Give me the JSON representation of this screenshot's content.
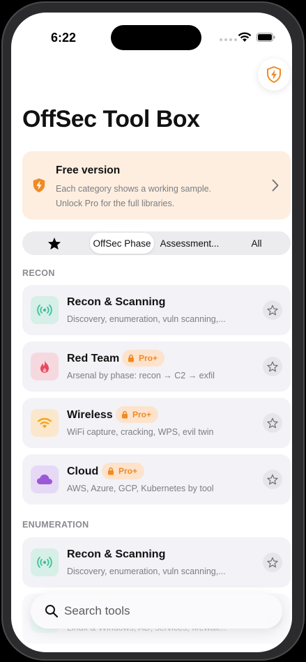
{
  "status": {
    "time": "6:22"
  },
  "title": "OffSec Tool Box",
  "banner": {
    "title": "Free version",
    "line1": "Each category shows a working sample.",
    "line2": "Unlock Pro for the full libraries."
  },
  "segments": {
    "phase": "OffSec Phase",
    "assessment": "Assessment...",
    "all": "All",
    "selected": "OffSec Phase"
  },
  "sections": [
    {
      "header": "RECON",
      "items": [
        {
          "title": "Recon & Scanning",
          "subtitle": "Discovery, enumeration, vuln scanning,...",
          "pro": false,
          "icon": "radio-waves-icon",
          "color": "#3fbf9a",
          "bg": "#d6efe7"
        },
        {
          "title": "Red Team",
          "subtitle": "Arsenal by phase: recon → C2 → exfil",
          "pro": true,
          "icon": "flame-icon",
          "color": "#e8475f",
          "bg": "#f6d9df"
        },
        {
          "title": "Wireless",
          "subtitle": "WiFi capture, cracking, WPS, evil twin",
          "pro": true,
          "icon": "wifi-icon",
          "color": "#f5a623",
          "bg": "#fbe8cc"
        },
        {
          "title": "Cloud",
          "subtitle": "AWS, Azure, GCP, Kubernetes by tool",
          "pro": true,
          "icon": "cloud-icon",
          "color": "#9b59d6",
          "bg": "#e6d9f6"
        }
      ]
    },
    {
      "header": "ENUMERATION",
      "items": [
        {
          "title": "Recon & Scanning",
          "subtitle": "Discovery, enumeration, vuln scanning,...",
          "pro": false,
          "icon": "radio-waves-icon",
          "color": "#3fbf9a",
          "bg": "#d6efe7"
        },
        {
          "title": "",
          "subtitle": "Linux & Windows, AD, services, firewall...",
          "pro": false,
          "icon": "",
          "color": "#3fbf9a",
          "bg": "#d6efe7"
        }
      ]
    }
  ],
  "pro_badge": "Pro+",
  "search": {
    "placeholder": "Search tools"
  },
  "colors": {
    "accent": "#f08a24",
    "banner_bg": "#fdeee0",
    "card_bg": "#f2f2f7"
  }
}
